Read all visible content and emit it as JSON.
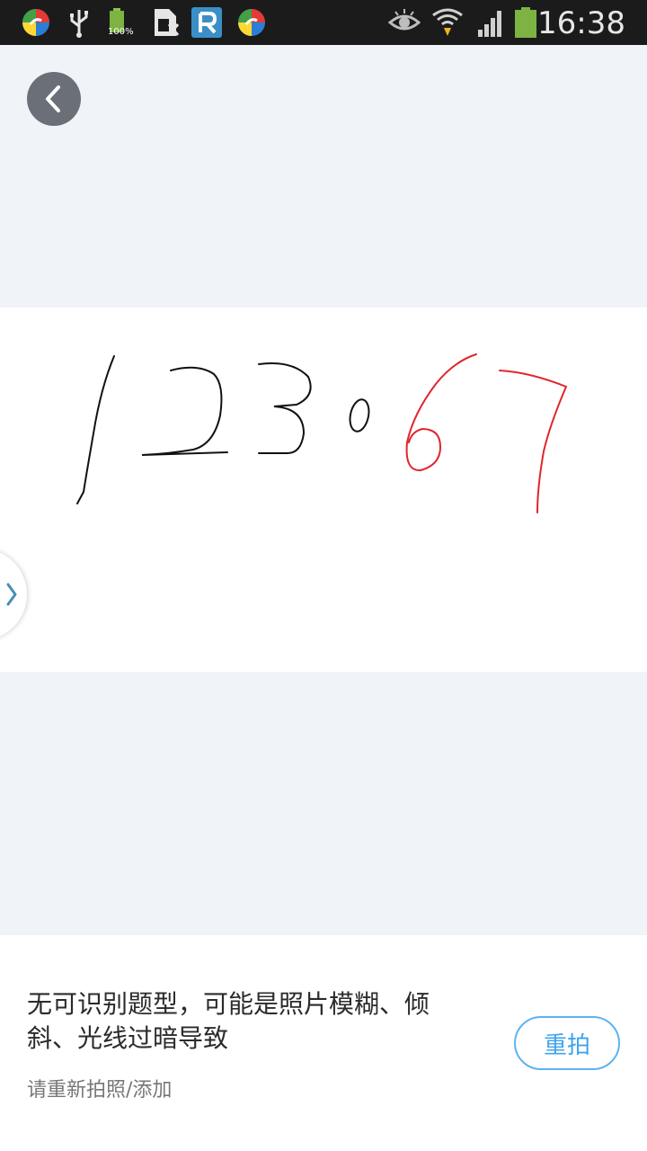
{
  "status_bar": {
    "battery_notify_label": "100%",
    "time": "16:38"
  },
  "photo": {
    "handwritten": [
      "1",
      "2",
      "3",
      "0",
      "6",
      "7"
    ],
    "ink_colors": {
      "black": "#111111",
      "red": "#e0262b"
    }
  },
  "bottom": {
    "message": "无可识别题型，可能是照片模糊、倾斜、光线过暗导致",
    "hint": "请重新拍照/添加",
    "retake_label": "重拍"
  },
  "colors": {
    "accent": "#3fa4ec",
    "background": "#f0f3f7",
    "back_button": "#6b6f78"
  }
}
